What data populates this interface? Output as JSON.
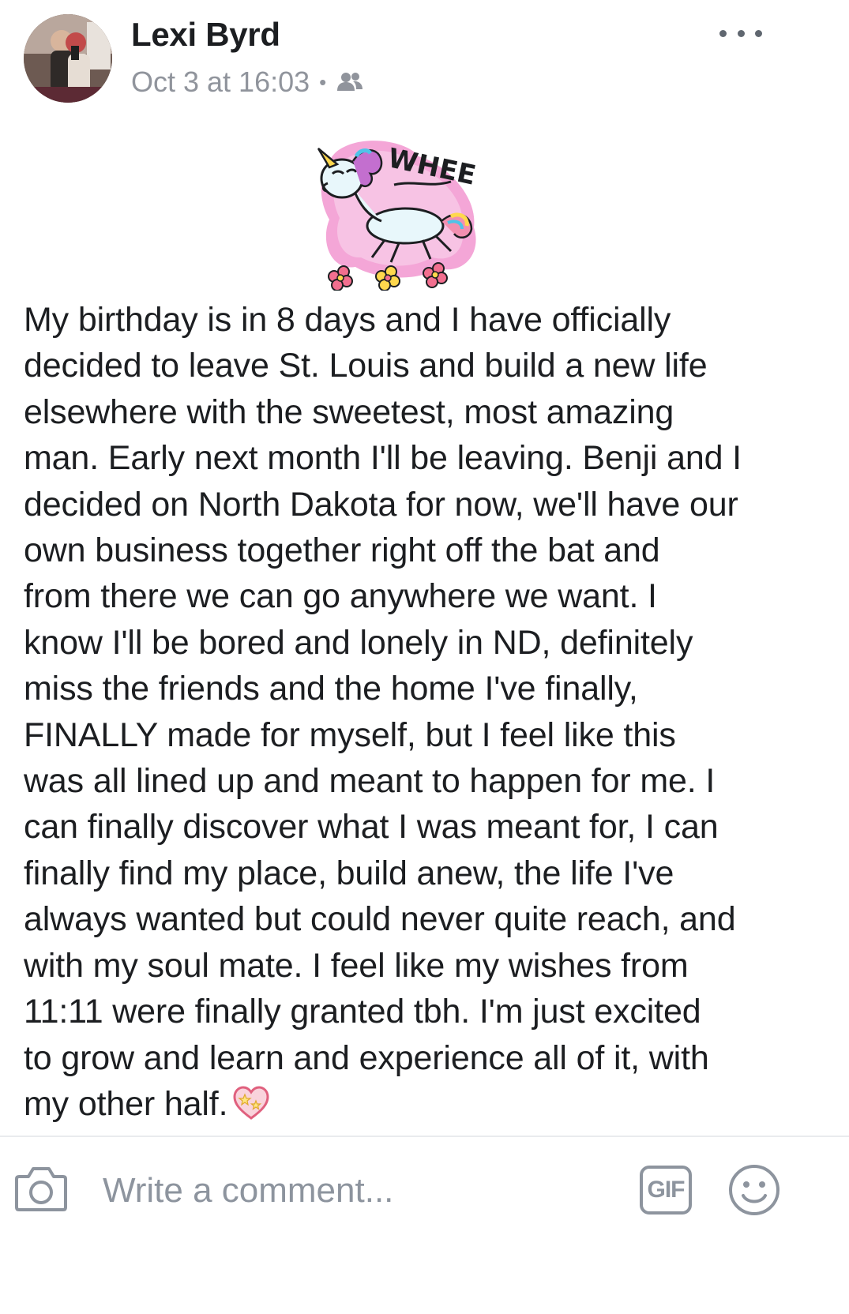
{
  "post": {
    "author": "Lexi Byrd",
    "timestamp": "Oct 3 at 16:03",
    "separator": "•",
    "audience_icon": "friends-icon",
    "more_icon": "more-horizontal-icon",
    "sticker": {
      "icon": "unicorn-sticker-icon",
      "text": "WHEE"
    },
    "text": "My birthday is in 8 days and I have officially\ndecided to leave St. Louis and build a new life\nelsewhere with the sweetest, most amazing\nman. Early next month I'll be leaving. Benji and I\ndecided on North Dakota for now, we'll have our\nown business together right off the bat and\nfrom there we can go anywhere we want. I\nknow I'll be bored and lonely in ND, definitely\nmiss the friends and the home I've finally,\nFINALLY made for myself, but I feel like this\nwas all lined up and meant to happen for me. I\ncan finally discover what I was meant for, I can\nfinally find my place, build anew, the life I've\nalways wanted but could never quite reach, and\nwith my soul mate. I feel like my wishes from\n11:11 were finally granted tbh. I'm just excited\nto grow and learn and experience all of it, with\nmy other half.",
    "trailing_emoji": "sparkling-heart-icon"
  },
  "comment_bar": {
    "camera_icon": "camera-icon",
    "placeholder": "Write a comment...",
    "gif_label": "GIF",
    "emoji_icon": "smiley-icon"
  },
  "colors": {
    "text": "#1c1e21",
    "meta": "#90949c",
    "icon_gray": "#8d949e",
    "divider": "#e9ebee"
  }
}
